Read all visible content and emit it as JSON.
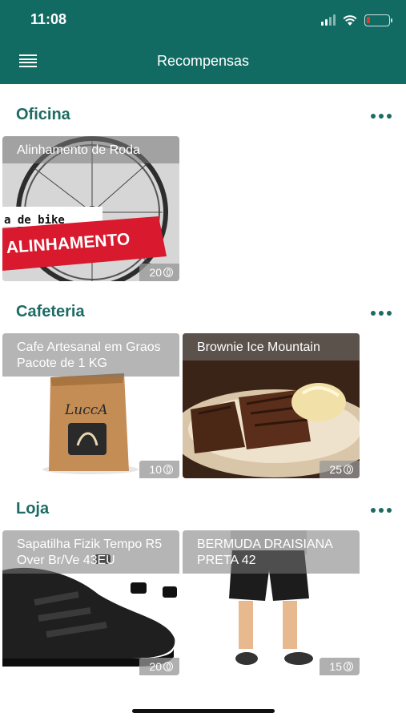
{
  "status": {
    "time": "11:08"
  },
  "header": {
    "title": "Recompensas"
  },
  "sections": [
    {
      "title": "Oficina",
      "items": [
        {
          "name": "Alinhamento de Roda",
          "points": "20",
          "banner_top": "a de bike",
          "banner_main": "ALINHAMENTO"
        }
      ]
    },
    {
      "title": "Cafeteria",
      "items": [
        {
          "name": "Cafe Artesanal em Graos Pacote de 1 KG",
          "points": "10",
          "bag_label": "LuccA"
        },
        {
          "name": "Brownie Ice Mountain",
          "points": "25"
        }
      ]
    },
    {
      "title": "Loja",
      "items": [
        {
          "name": "Sapatilha Fizik Tempo R5 Over Br/Ve 43EU",
          "points": "20"
        },
        {
          "name": "BERMUDA DRAISIANA PRETA 42",
          "points": "15"
        }
      ]
    }
  ],
  "colors": {
    "header_bg": "#116b63",
    "accent": "#1d6b63",
    "banner_red": "#d8192e"
  }
}
